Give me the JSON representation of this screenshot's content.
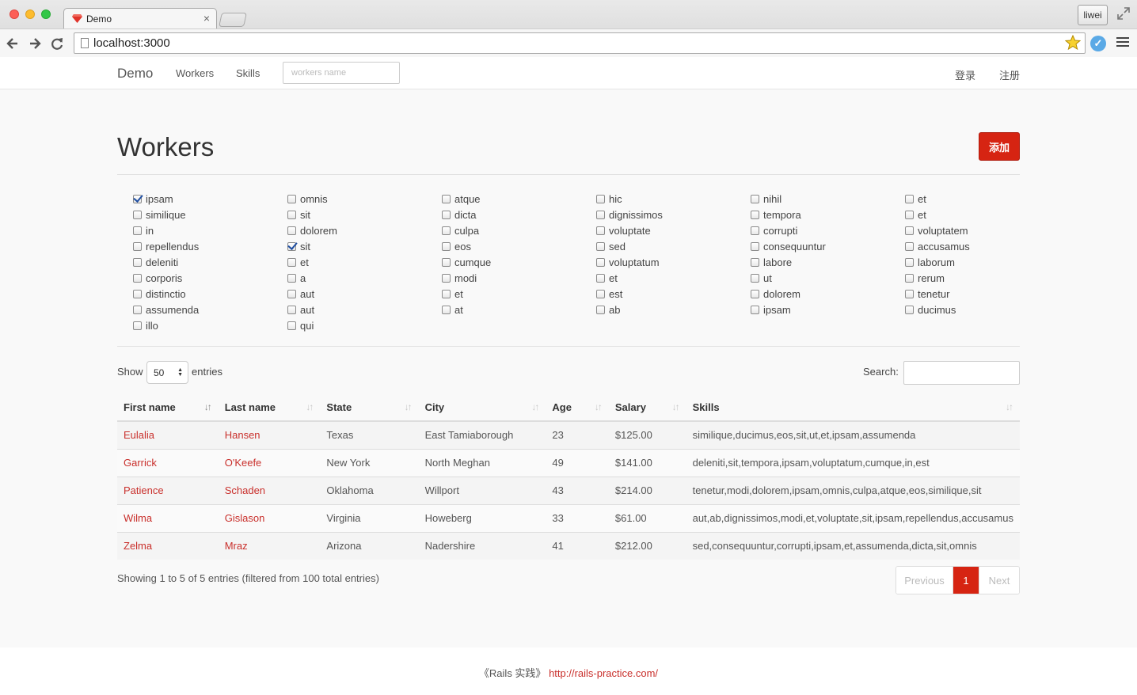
{
  "browser": {
    "tab_title": "Demo",
    "url": "localhost:3000",
    "profile": "liwei"
  },
  "navbar": {
    "brand": "Demo",
    "links": [
      "Workers",
      "Skills"
    ],
    "search_placeholder": "workers name",
    "login": "登录",
    "register": "注册"
  },
  "page": {
    "title": "Workers",
    "add_button": "添加"
  },
  "skills": [
    [
      {
        "label": "ipsam",
        "checked": true
      },
      {
        "label": "similique",
        "checked": false
      },
      {
        "label": "in",
        "checked": false
      },
      {
        "label": "repellendus",
        "checked": false
      },
      {
        "label": "deleniti",
        "checked": false
      },
      {
        "label": "corporis",
        "checked": false
      },
      {
        "label": "distinctio",
        "checked": false
      },
      {
        "label": "assumenda",
        "checked": false
      },
      {
        "label": "illo",
        "checked": false
      }
    ],
    [
      {
        "label": "omnis",
        "checked": false
      },
      {
        "label": "sit",
        "checked": false
      },
      {
        "label": "dolorem",
        "checked": false
      },
      {
        "label": "sit",
        "checked": true
      },
      {
        "label": "et",
        "checked": false
      },
      {
        "label": "a",
        "checked": false
      },
      {
        "label": "aut",
        "checked": false
      },
      {
        "label": "aut",
        "checked": false
      },
      {
        "label": "qui",
        "checked": false
      }
    ],
    [
      {
        "label": "atque",
        "checked": false
      },
      {
        "label": "dicta",
        "checked": false
      },
      {
        "label": "culpa",
        "checked": false
      },
      {
        "label": "eos",
        "checked": false
      },
      {
        "label": "cumque",
        "checked": false
      },
      {
        "label": "modi",
        "checked": false
      },
      {
        "label": "et",
        "checked": false
      },
      {
        "label": "at",
        "checked": false
      }
    ],
    [
      {
        "label": "hic",
        "checked": false
      },
      {
        "label": "dignissimos",
        "checked": false
      },
      {
        "label": "voluptate",
        "checked": false
      },
      {
        "label": "sed",
        "checked": false
      },
      {
        "label": "voluptatum",
        "checked": false
      },
      {
        "label": "et",
        "checked": false
      },
      {
        "label": "est",
        "checked": false
      },
      {
        "label": "ab",
        "checked": false
      }
    ],
    [
      {
        "label": "nihil",
        "checked": false
      },
      {
        "label": "tempora",
        "checked": false
      },
      {
        "label": "corrupti",
        "checked": false
      },
      {
        "label": "consequuntur",
        "checked": false
      },
      {
        "label": "labore",
        "checked": false
      },
      {
        "label": "ut",
        "checked": false
      },
      {
        "label": "dolorem",
        "checked": false
      },
      {
        "label": "ipsam",
        "checked": false
      }
    ],
    [
      {
        "label": "et",
        "checked": false
      },
      {
        "label": "et",
        "checked": false
      },
      {
        "label": "voluptatem",
        "checked": false
      },
      {
        "label": "accusamus",
        "checked": false
      },
      {
        "label": "laborum",
        "checked": false
      },
      {
        "label": "rerum",
        "checked": false
      },
      {
        "label": "tenetur",
        "checked": false
      },
      {
        "label": "ducimus",
        "checked": false
      }
    ]
  ],
  "table_controls": {
    "show": "Show",
    "length_value": "50",
    "entries": "entries",
    "search_label": "Search:"
  },
  "table": {
    "columns": [
      "First name",
      "Last name",
      "State",
      "City",
      "Age",
      "Salary",
      "Skills"
    ],
    "sorted_column": 0,
    "rows": [
      [
        "Eulalia",
        "Hansen",
        "Texas",
        "East Tamiaborough",
        "23",
        "$125.00",
        "similique,ducimus,eos,sit,ut,et,ipsam,assumenda"
      ],
      [
        "Garrick",
        "O'Keefe",
        "New York",
        "North Meghan",
        "49",
        "$141.00",
        "deleniti,sit,tempora,ipsam,voluptatum,cumque,in,est"
      ],
      [
        "Patience",
        "Schaden",
        "Oklahoma",
        "Willport",
        "43",
        "$214.00",
        "tenetur,modi,dolorem,ipsam,omnis,culpa,atque,eos,similique,sit"
      ],
      [
        "Wilma",
        "Gislason",
        "Virginia",
        "Howeberg",
        "33",
        "$61.00",
        "aut,ab,dignissimos,modi,et,voluptate,sit,ipsam,repellendus,accusamus"
      ],
      [
        "Zelma",
        "Mraz",
        "Arizona",
        "Nadershire",
        "41",
        "$212.00",
        "sed,consequuntur,corrupti,ipsam,et,assumenda,dicta,sit,omnis"
      ]
    ]
  },
  "info": "Showing 1 to 5 of 5 entries (filtered from 100 total entries)",
  "pagination": {
    "previous": "Previous",
    "current": "1",
    "next": "Next"
  },
  "footer": {
    "text": "《Rails 实践》",
    "link": "http://rails-practice.com/"
  },
  "colors": {
    "accent": "#d62412",
    "link": "#c9302c"
  }
}
